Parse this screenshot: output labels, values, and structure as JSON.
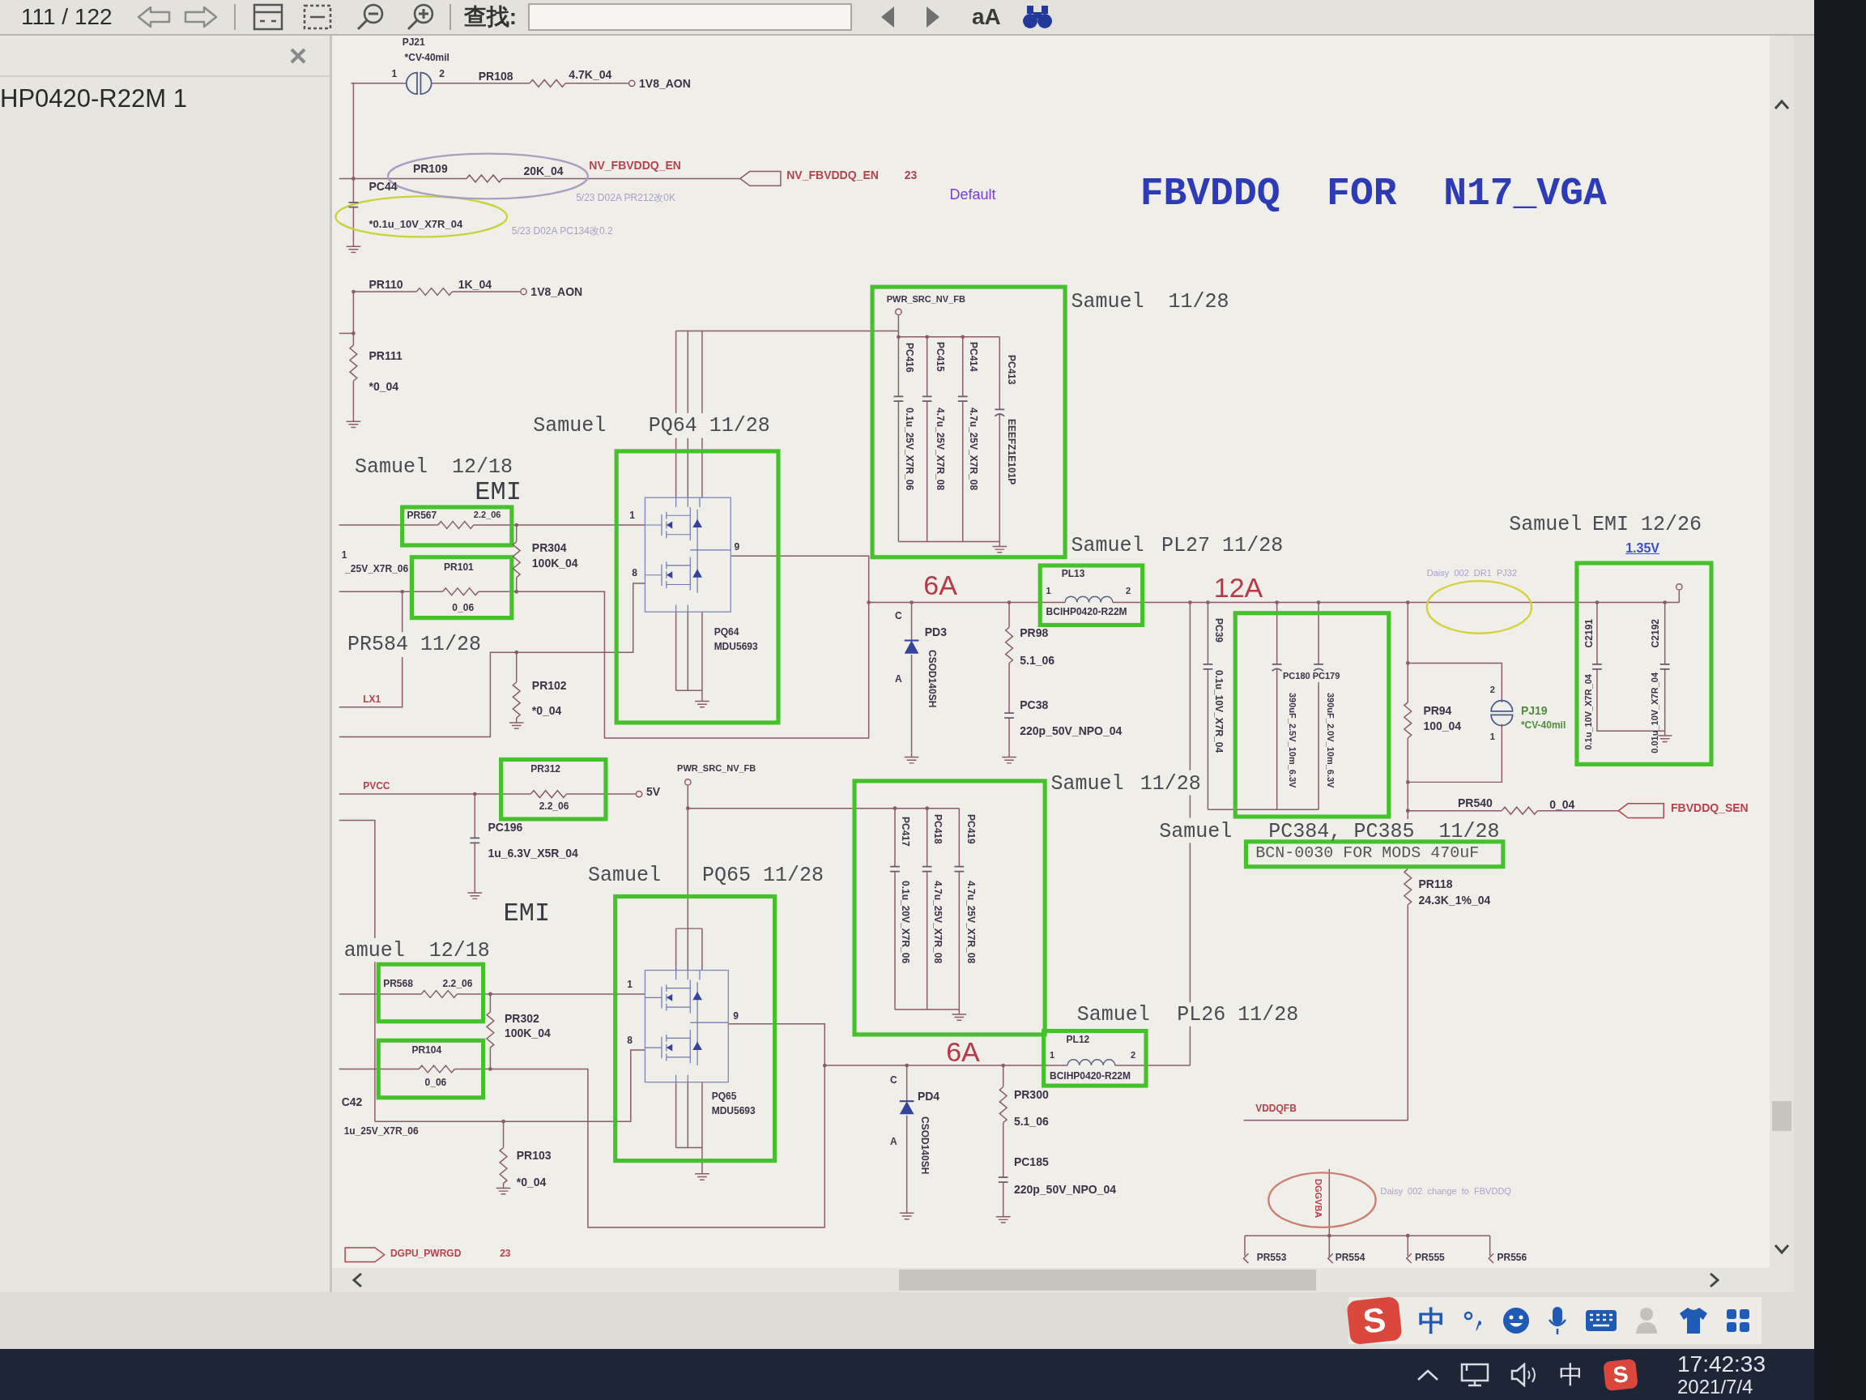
{
  "toolbar": {
    "page_indicator": "111 / 122",
    "find_label": "查找:",
    "match_case_label": "aA"
  },
  "side_panel": {
    "items": [
      {
        "label": "HP0420-R22M 1",
        "selected": false
      }
    ]
  },
  "schematic": {
    "labels": [
      {
        "text": "PJ21",
        "kind": "ref"
      },
      {
        "text": "*CV-40mil",
        "kind": "ref"
      },
      {
        "text": "1",
        "kind": "pin"
      },
      {
        "text": "2",
        "kind": "pin"
      },
      {
        "text": "PR108",
        "kind": "ref"
      },
      {
        "text": "4.7K_04",
        "kind": "ref"
      },
      {
        "text": "1V8_AON",
        "kind": "net"
      },
      {
        "text": "PR109",
        "kind": "ref"
      },
      {
        "text": "20K_04",
        "kind": "ref"
      },
      {
        "text": "NV_FBVDDQ_EN",
        "kind": "signal"
      },
      {
        "text": "NV_FBVDDQ_EN",
        "kind": "signal"
      },
      {
        "text": "23",
        "kind": "signal"
      },
      {
        "text": "PC44",
        "kind": "ref"
      },
      {
        "text": "5/23 D02A PR212改0K",
        "kind": "faint"
      },
      {
        "text": "Default",
        "kind": "purple"
      },
      {
        "text": "FBVDDQ  FOR  N17_VGA",
        "kind": "title"
      },
      {
        "text": "*0.1u_10V_X7R_04",
        "kind": "ref"
      },
      {
        "text": "5/23 D02A PC134改0.2",
        "kind": "faint"
      },
      {
        "text": "PR110",
        "kind": "ref"
      },
      {
        "text": "1K_04",
        "kind": "ref"
      },
      {
        "text": "1V8_AON",
        "kind": "net"
      },
      {
        "text": "PWR_SRC_NV_FB",
        "kind": "net"
      },
      {
        "text": "Samuel  11/28",
        "kind": "note"
      },
      {
        "text": "PR111",
        "kind": "ref"
      },
      {
        "text": "*0_04",
        "kind": "ref"
      },
      {
        "text": "PC416",
        "kind": "ref"
      },
      {
        "text": "PC415",
        "kind": "ref"
      },
      {
        "text": "PC414",
        "kind": "ref"
      },
      {
        "text": "PC413",
        "kind": "ref"
      },
      {
        "text": "Samuel",
        "kind": "note"
      },
      {
        "text": "PQ64 11/28",
        "kind": "note"
      },
      {
        "text": "Samuel  12/18",
        "kind": "note"
      },
      {
        "text": "EMI",
        "kind": "emi"
      },
      {
        "text": "0.1u_25V_X7R_06",
        "kind": "ref"
      },
      {
        "text": "4.7u_25V_X7R_08",
        "kind": "ref"
      },
      {
        "text": "4.7u_25V_X7R_08",
        "kind": "ref"
      },
      {
        "text": "EEEFZ1E101P",
        "kind": "ref"
      },
      {
        "text": "PR567",
        "kind": "ref"
      },
      {
        "text": "2.2_06",
        "kind": "ref"
      },
      {
        "text": "1",
        "kind": "pin"
      },
      {
        "text": "Samuel",
        "kind": "note"
      },
      {
        "text": "EMI 12/26",
        "kind": "note"
      },
      {
        "text": "1",
        "kind": "pin"
      },
      {
        "text": "PR304",
        "kind": "ref"
      },
      {
        "text": "9",
        "kind": "pin"
      },
      {
        "text": "Samuel",
        "kind": "note"
      },
      {
        "text": "PL27 11/28",
        "kind": "note"
      },
      {
        "text": "1.35V",
        "kind": "voltage"
      },
      {
        "text": "_25V_X7R_06",
        "kind": "ref"
      },
      {
        "text": "PR101",
        "kind": "ref"
      },
      {
        "text": "100K_04",
        "kind": "ref"
      },
      {
        "text": "8",
        "kind": "pin"
      },
      {
        "text": "6A",
        "kind": "current"
      },
      {
        "text": "PL13",
        "kind": "ref"
      },
      {
        "text": "1",
        "kind": "pin"
      },
      {
        "text": "2",
        "kind": "pin"
      },
      {
        "text": "12A",
        "kind": "current"
      },
      {
        "text": "Daisy  002  DR1  PJ32",
        "kind": "faint"
      },
      {
        "text": "0_06",
        "kind": "ref"
      },
      {
        "text": "C",
        "kind": "pin"
      },
      {
        "text": "BCIHP0420-R22M",
        "kind": "ref"
      },
      {
        "text": "PR584 11/28",
        "kind": "note"
      },
      {
        "text": "PQ64",
        "kind": "ref"
      },
      {
        "text": "MDU5693",
        "kind": "ref"
      },
      {
        "text": "PD3",
        "kind": "ref"
      },
      {
        "text": "PR98",
        "kind": "ref"
      },
      {
        "text": "PC39",
        "kind": "ref"
      },
      {
        "text": "C2191",
        "kind": "ref"
      },
      {
        "text": "C2192",
        "kind": "ref"
      },
      {
        "text": "PR102",
        "kind": "ref"
      },
      {
        "text": "A",
        "kind": "pin"
      },
      {
        "text": "LX1",
        "kind": "signal"
      },
      {
        "text": "CSOD140SH",
        "kind": "ref"
      },
      {
        "text": "5.1_06",
        "kind": "ref"
      },
      {
        "text": "*0_04",
        "kind": "ref"
      },
      {
        "text": "PC38",
        "kind": "ref"
      },
      {
        "text": "220p_50V_NPO_04",
        "kind": "ref"
      },
      {
        "text": "0.1u_10V_X7R_04",
        "kind": "ref"
      },
      {
        "text": "PC180 PC179",
        "kind": "ref"
      },
      {
        "text": "PR312",
        "kind": "ref"
      },
      {
        "text": "PWR_SRC_NV_FB",
        "kind": "net"
      },
      {
        "text": "PVCC",
        "kind": "signal"
      },
      {
        "text": "5V",
        "kind": "net"
      },
      {
        "text": "Samuel",
        "kind": "note"
      },
      {
        "text": "11/28",
        "kind": "note"
      },
      {
        "text": "390uF_2.5V_10m_6.3V",
        "kind": "ref"
      },
      {
        "text": "390uF_2.0V_10m_6.3V",
        "kind": "ref"
      },
      {
        "text": "2",
        "kind": "pin"
      },
      {
        "text": "PR94",
        "kind": "ref"
      },
      {
        "text": "PJ19",
        "kind": "green"
      },
      {
        "text": "100_04",
        "kind": "ref"
      },
      {
        "text": "*CV-40mil",
        "kind": "green"
      },
      {
        "text": "1",
        "kind": "pin"
      },
      {
        "text": "0.1u_10V_X7R_04",
        "kind": "ref"
      },
      {
        "text": "0.01u_10V_X7R_04",
        "kind": "ref"
      },
      {
        "text": "2.2_06",
        "kind": "ref"
      },
      {
        "text": "PR540",
        "kind": "ref"
      },
      {
        "text": "0_04",
        "kind": "ref"
      },
      {
        "text": "FBVDDQ_SEN",
        "kind": "signal"
      },
      {
        "text": "PC196",
        "kind": "ref"
      },
      {
        "text": "PC417",
        "kind": "ref"
      },
      {
        "text": "PC418",
        "kind": "ref"
      },
      {
        "text": "PC419",
        "kind": "ref"
      },
      {
        "text": "Samuel",
        "kind": "note"
      },
      {
        "text": "PC384, PC385  11/28",
        "kind": "note"
      },
      {
        "text": "1u_6.3V_X5R_04",
        "kind": "ref"
      },
      {
        "text": "BCN-0030 FOR MODS 470uF",
        "kind": "bom"
      },
      {
        "text": "Samuel",
        "kind": "note"
      },
      {
        "text": "PQ65 11/28",
        "kind": "note"
      },
      {
        "text": "EMI",
        "kind": "emi"
      },
      {
        "text": "amuel  12/18",
        "kind": "note"
      },
      {
        "text": "0.1u_20V_X7R_06",
        "kind": "ref"
      },
      {
        "text": "4.7u_25V_X7R_08",
        "kind": "ref"
      },
      {
        "text": "4.7u_25V_X7R_08",
        "kind": "ref"
      },
      {
        "text": "PR118",
        "kind": "ref"
      },
      {
        "text": "24.3K_1%_04",
        "kind": "ref"
      },
      {
        "text": "PR568",
        "kind": "ref"
      },
      {
        "text": "2.2_06",
        "kind": "ref"
      },
      {
        "text": "1",
        "kind": "pin"
      },
      {
        "text": "PR302",
        "kind": "ref"
      },
      {
        "text": "9",
        "kind": "pin"
      },
      {
        "text": "Samuel",
        "kind": "note"
      },
      {
        "text": "PL26 11/28",
        "kind": "note"
      },
      {
        "text": "100K_04",
        "kind": "ref"
      },
      {
        "text": "PR104",
        "kind": "ref"
      },
      {
        "text": "8",
        "kind": "pin"
      },
      {
        "text": "6A",
        "kind": "current"
      },
      {
        "text": "PL12",
        "kind": "ref"
      },
      {
        "text": "1",
        "kind": "pin"
      },
      {
        "text": "2",
        "kind": "pin"
      },
      {
        "text": "0_06",
        "kind": "ref"
      },
      {
        "text": "C",
        "kind": "pin"
      },
      {
        "text": "BCIHP0420-R22M",
        "kind": "ref"
      },
      {
        "text": "C42",
        "kind": "ref"
      },
      {
        "text": "PQ65",
        "kind": "ref"
      },
      {
        "text": "PD4",
        "kind": "ref"
      },
      {
        "text": "PR300",
        "kind": "ref"
      },
      {
        "text": "MDU5693",
        "kind": "ref"
      },
      {
        "text": "VDDQFB",
        "kind": "signal"
      },
      {
        "text": "1u_25V_X7R_06",
        "kind": "ref"
      },
      {
        "text": "A",
        "kind": "pin"
      },
      {
        "text": "PR103",
        "kind": "ref"
      },
      {
        "text": "CSOD140SH",
        "kind": "ref"
      },
      {
        "text": "5.1_06",
        "kind": "ref"
      },
      {
        "text": "PC185",
        "kind": "ref"
      },
      {
        "text": "*0_04",
        "kind": "ref"
      },
      {
        "text": "220p_50V_NPO_04",
        "kind": "ref"
      },
      {
        "text": "DGGVBA",
        "kind": "signal"
      },
      {
        "text": "Daisy  002  change  to  FBVDDQ",
        "kind": "faint"
      },
      {
        "text": "DGPU_PWRGD",
        "kind": "signal"
      },
      {
        "text": "23",
        "kind": "signal"
      },
      {
        "text": "PR553",
        "kind": "ref"
      },
      {
        "text": "PR554",
        "kind": "ref"
      },
      {
        "text": "PR555",
        "kind": "ref"
      },
      {
        "text": "PR556",
        "kind": "ref"
      }
    ]
  },
  "ime_bar": {
    "logo": "S",
    "mode": "中"
  },
  "taskbar": {
    "ime_mode": "中",
    "logo": "S",
    "time": "17:42:33",
    "date": "2021/7/4"
  }
}
